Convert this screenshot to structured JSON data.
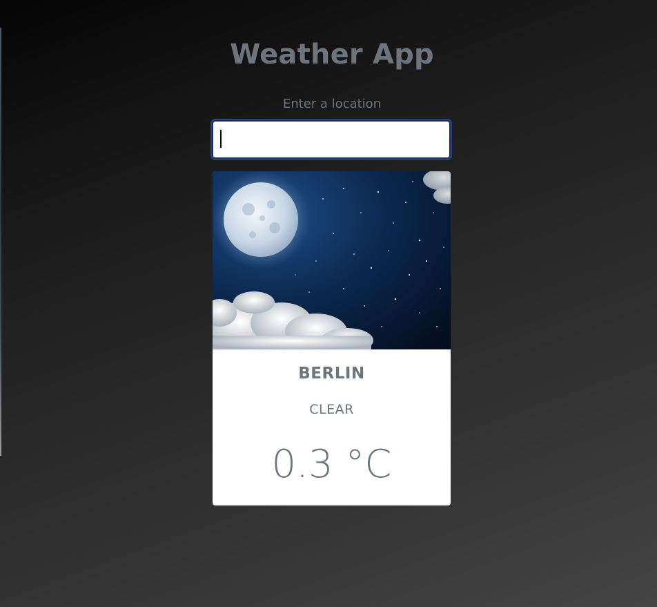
{
  "app": {
    "title": "Weather App"
  },
  "search": {
    "label": "Enter a location",
    "value": "",
    "placeholder": ""
  },
  "card": {
    "image_icon": "night-sky-moon-image",
    "city": "BERLIN",
    "condition": "CLEAR",
    "temperature": "0.3 °C"
  },
  "colors": {
    "text_muted": "#6c757d",
    "input_border": "#1e2f57",
    "card_bg": "#ffffff"
  }
}
